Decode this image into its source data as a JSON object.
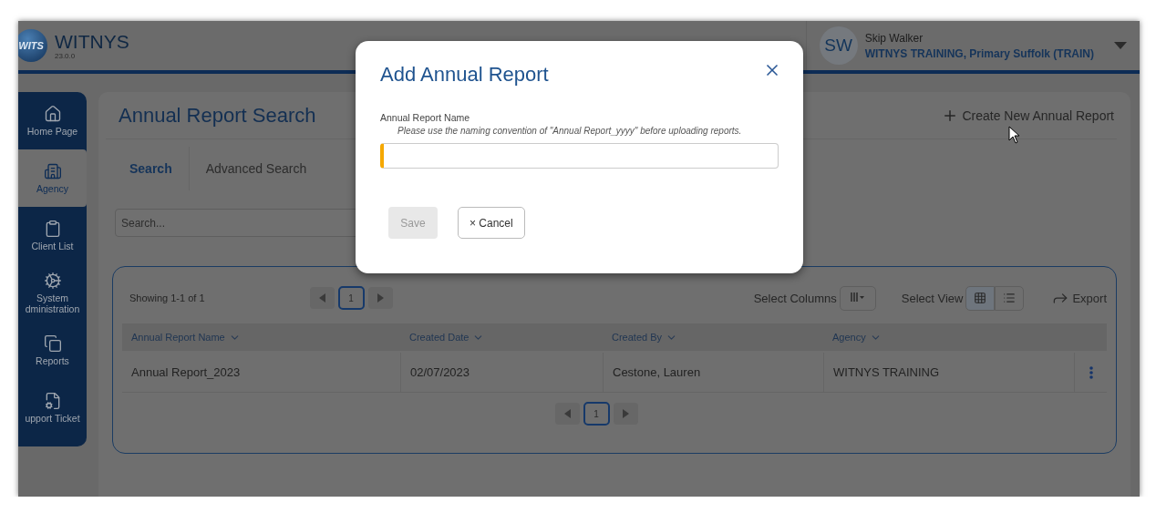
{
  "header": {
    "logo_text": "WITS",
    "app_name": "WITNYS",
    "version": "23.0.0",
    "user": {
      "initials": "SW",
      "name": "Skip Walker",
      "org": "WITNYS TRAINING, Primary Suffolk (TRAIN)"
    }
  },
  "sidebar": {
    "items": [
      {
        "label": "Home Page",
        "selected": false
      },
      {
        "label": "Agency",
        "selected": true
      },
      {
        "label": "Client List",
        "selected": false
      },
      {
        "label": "System dministration",
        "selected": false
      },
      {
        "label": "Reports",
        "selected": false
      },
      {
        "label": "upport Ticket",
        "selected": false
      }
    ]
  },
  "page": {
    "title": "Annual Report Search",
    "create_button": "Create New Annual Report",
    "tabs": [
      {
        "label": "Search",
        "selected": true
      },
      {
        "label": "Advanced Search",
        "selected": false
      }
    ],
    "search": {
      "placeholder": "Search..."
    }
  },
  "results": {
    "summary": "Showing 1-1 of 1",
    "pager": {
      "page": "1"
    },
    "select_columns": "Select Columns",
    "select_view": "Select View",
    "views": [
      {
        "kind": "grid",
        "selected": true
      },
      {
        "kind": "list",
        "selected": false
      }
    ],
    "export": "Export",
    "columns": [
      "Annual Report Name",
      "Created Date",
      "Created By",
      "Agency"
    ],
    "rows": [
      {
        "cells": [
          "Annual Report_2023",
          "02/07/2023",
          "Cestone, Lauren",
          "WITNYS TRAINING"
        ]
      }
    ],
    "bottom_pager": {
      "page": "1"
    }
  },
  "dialog": {
    "title": "Add Annual Report",
    "field_label": "Annual Report Name",
    "hint": "Please use the naming convention of \"Annual Report_yyyy\" before uploading reports.",
    "required": true,
    "save": {
      "label": "Save",
      "disabled": true
    },
    "cancel": {
      "label": "× Cancel"
    }
  }
}
